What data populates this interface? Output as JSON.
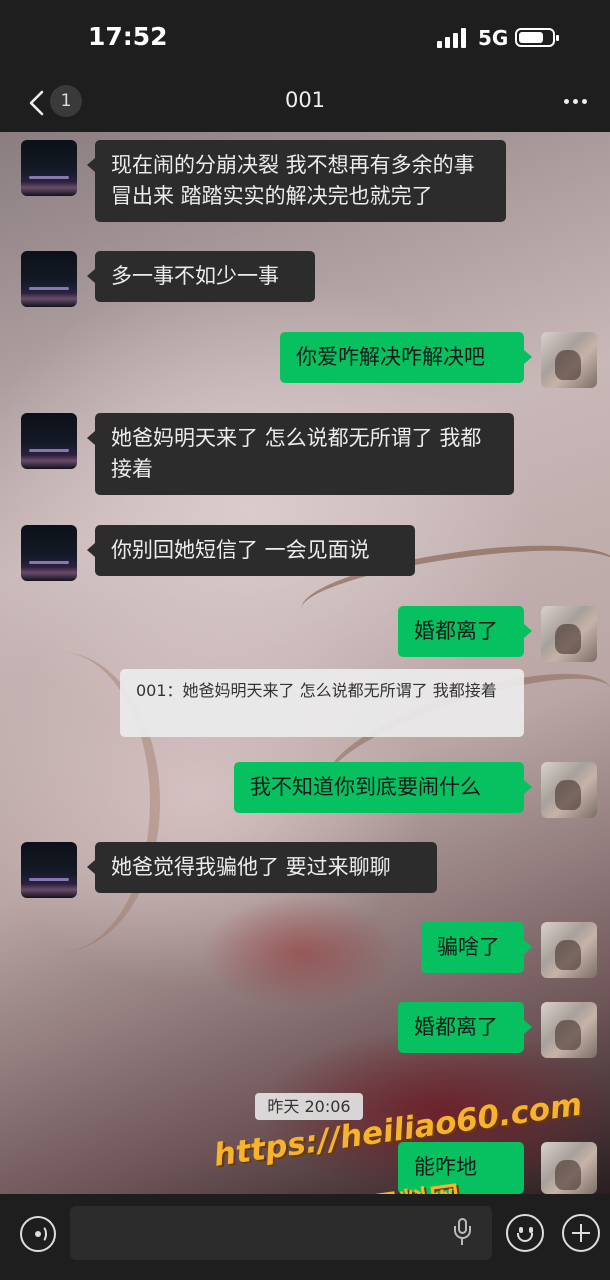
{
  "status_bar": {
    "time": "17:52",
    "network": "5G",
    "battery_level": 0.7
  },
  "header": {
    "back_badge": "1",
    "title": "001"
  },
  "messages": [
    {
      "side": "in",
      "text": "现在闹的分崩决裂 我不想再有多余的事冒出来 踏踏实实的解决完也就完了"
    },
    {
      "side": "in",
      "text": "多一事不如少一事"
    },
    {
      "side": "out",
      "text": "你爱咋解决咋解决吧"
    },
    {
      "side": "in",
      "text": "她爸妈明天来了 怎么说都无所谓了 我都接着"
    },
    {
      "side": "in",
      "text": "你别回她短信了 一会见面说"
    },
    {
      "side": "out",
      "text": "婚都离了",
      "quote": "001：她爸妈明天来了 怎么说都无所谓了 我都接着"
    },
    {
      "side": "out",
      "text": "我不知道你到底要闹什么"
    },
    {
      "side": "in",
      "text": "她爸觉得我骗他了 要过来聊聊"
    },
    {
      "side": "out",
      "text": "骗啥了"
    },
    {
      "side": "out",
      "text": "婚都离了"
    },
    {
      "side": "out",
      "text": "能咋地"
    }
  ],
  "time_divider": "昨天 20:06",
  "watermark": {
    "url": "https://heiliao60.com",
    "label": "黑料网"
  },
  "input": {
    "value": "",
    "placeholder": ""
  },
  "icons": {
    "back": "chevron-left-icon",
    "more": "more-dots-icon",
    "voice": "voice-icon",
    "mic": "mic-icon",
    "emoji": "emoji-icon",
    "plus": "plus-icon"
  },
  "colors": {
    "out_bubble": "#07c160",
    "in_bubble": "#2c2c2c",
    "bar_bg": "#1e1e1e"
  }
}
